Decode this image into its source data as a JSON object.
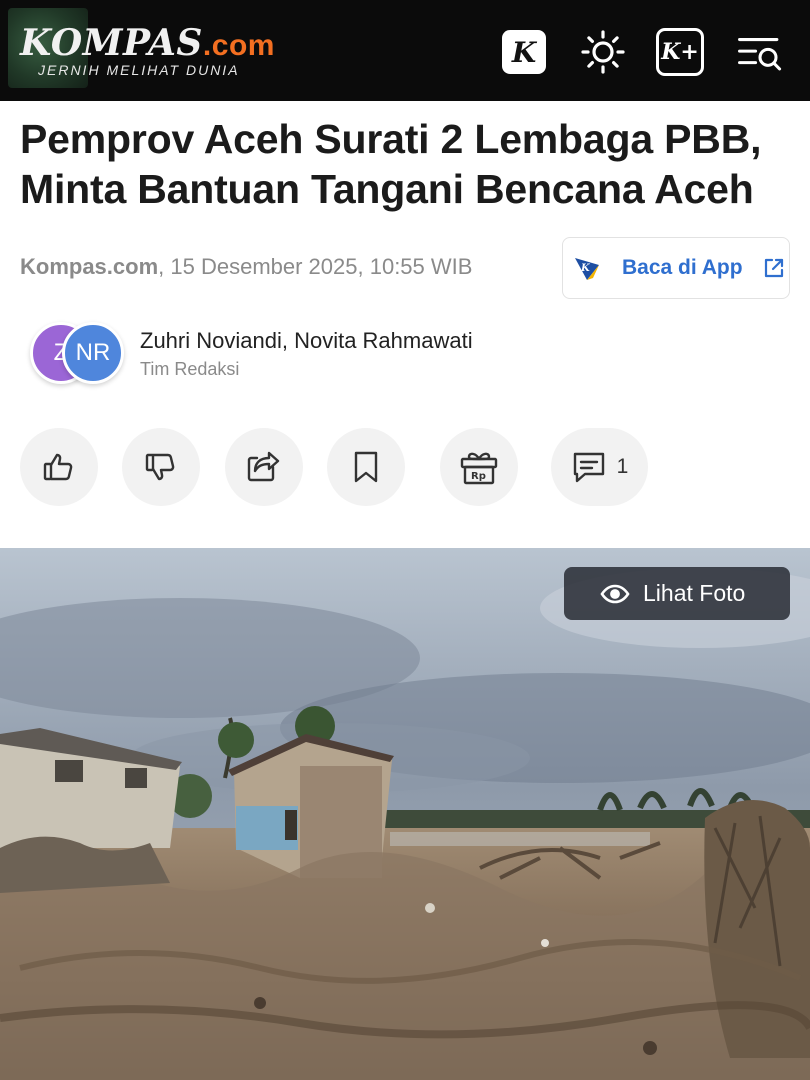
{
  "header": {
    "logo_text": "KOMPAS",
    "logo_suffix": ".com",
    "tagline": "JERNIH MELIHAT DUNIA",
    "icons": [
      "kompas-k-icon",
      "sun-icon",
      "kompas-plus-icon",
      "menu-search-icon"
    ],
    "k_letter": "K",
    "kplus_label": "K+",
    "colors": {
      "background": "#0b0b0b",
      "accent": "#f36f21"
    }
  },
  "article": {
    "title": "Pemprov Aceh Surati 2 Lembaga PBB, Minta Bantuan Tangani Bencana Aceh",
    "source": "Kompas.com",
    "date": ", 15 Desember 2025, 10:55 WIB",
    "app_button": "Baca di App",
    "authors": "Zuhri Noviandi,  Novita Rahmawati",
    "team": "Tim Redaksi",
    "avatar_initials": [
      "Z",
      "NR"
    ],
    "comment_count": "1",
    "photo_button": "Lihat Foto"
  },
  "actions": {
    "icons": [
      "thumbs-up-icon",
      "thumbs-down-icon",
      "share-icon",
      "bookmark-icon",
      "gift-icon",
      "comment-icon"
    ]
  }
}
